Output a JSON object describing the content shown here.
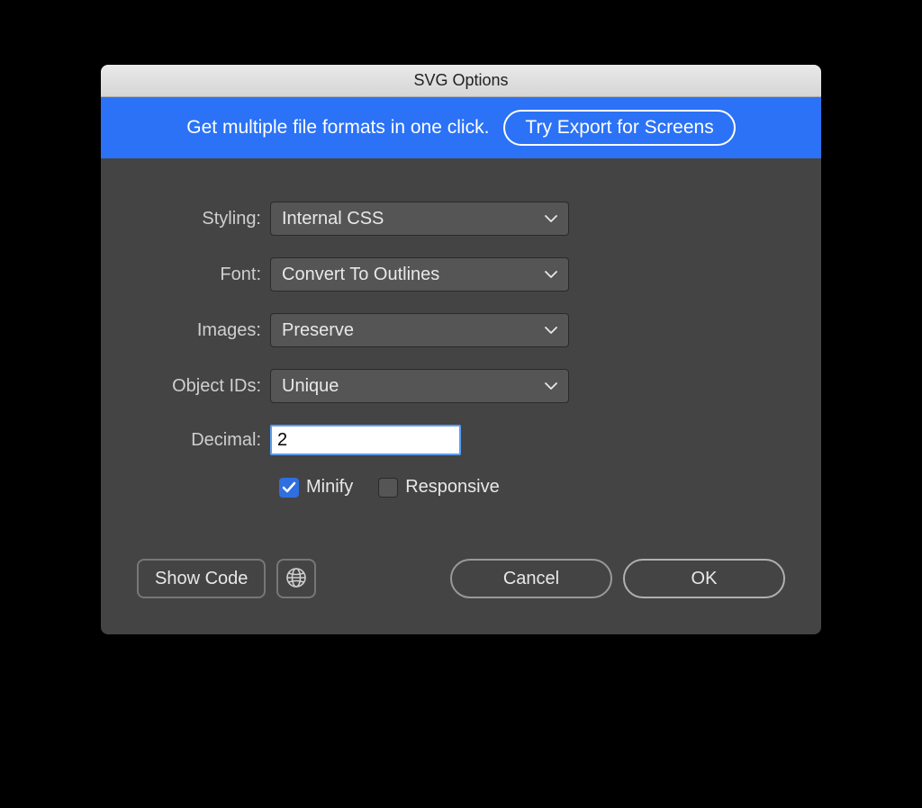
{
  "window": {
    "title": "SVG Options"
  },
  "banner": {
    "text": "Get multiple file formats in one click.",
    "button_label": "Try Export for Screens"
  },
  "form": {
    "styling": {
      "label": "Styling:",
      "value": "Internal CSS"
    },
    "font": {
      "label": "Font:",
      "value": "Convert To Outlines"
    },
    "images": {
      "label": "Images:",
      "value": "Preserve"
    },
    "object_ids": {
      "label": "Object IDs:",
      "value": "Unique"
    },
    "decimal": {
      "label": "Decimal:",
      "value": "2"
    },
    "minify": {
      "label": "Minify",
      "checked": true
    },
    "responsive": {
      "label": "Responsive",
      "checked": false
    }
  },
  "buttons": {
    "show_code": "Show Code",
    "cancel": "Cancel",
    "ok": "OK"
  }
}
